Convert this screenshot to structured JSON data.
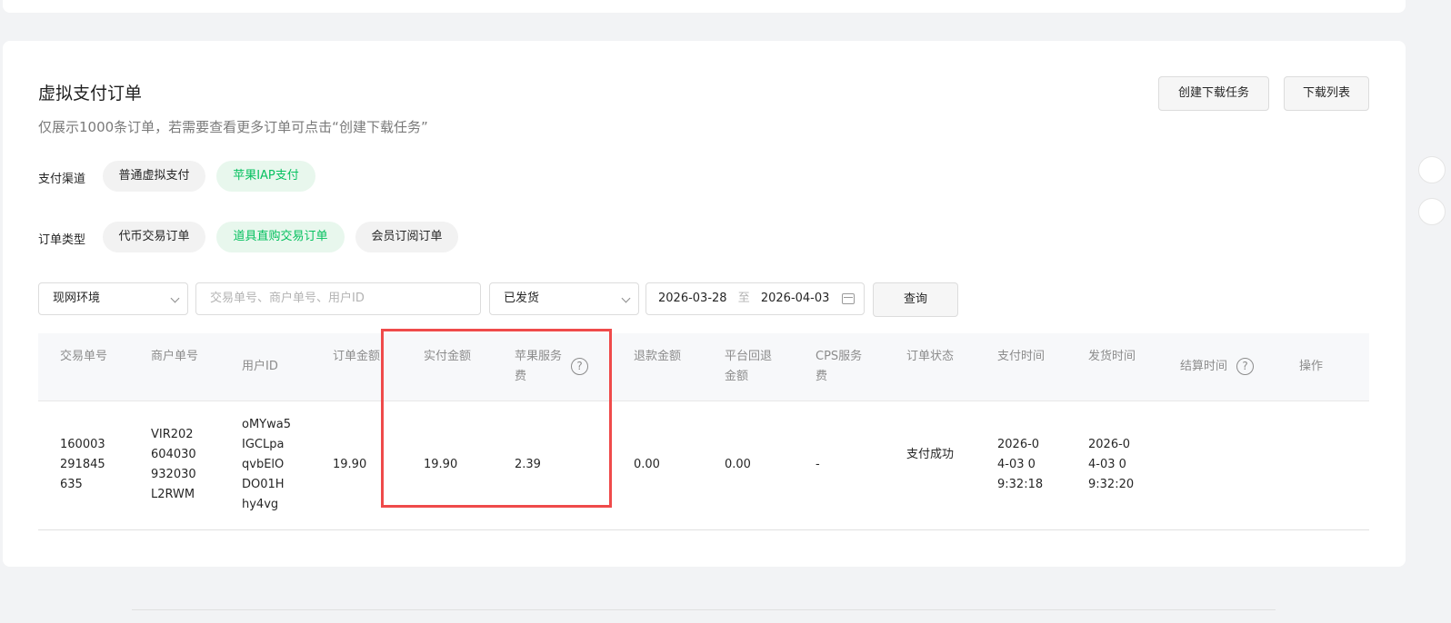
{
  "header": {
    "title": "虚拟支付订单",
    "subtitle": "仅展示1000条订单，若需要查看更多订单可点击“创建下载任务”",
    "create_download_label": "创建下载任务",
    "download_list_label": "下载列表"
  },
  "filters": {
    "channel_label": "支付渠道",
    "channels": [
      "普通虚拟支付",
      "苹果IAP支付"
    ],
    "channel_active": "苹果IAP支付",
    "type_label": "订单类型",
    "types": [
      "代币交易订单",
      "道具直购交易订单",
      "会员订阅订单"
    ],
    "type_active": "道具直购交易订单"
  },
  "search": {
    "env_value": "现网环境",
    "keyword_placeholder": "交易单号、商户单号、用户ID",
    "status_value": "已发货",
    "date_start": "2026-03-28",
    "date_sep": "至",
    "date_end": "2026-04-03",
    "query_label": "查询"
  },
  "table": {
    "columns": [
      "交易单号",
      "商户单号",
      "用户ID",
      "订单金额",
      "实付金额",
      "苹果服务费",
      "退款金额",
      "平台回退金额",
      "CPS服务费",
      "订单状态",
      "支付时间",
      "发货时间",
      "结算时间",
      "操作"
    ],
    "rows": [
      {
        "trade_no": "160003291845635",
        "merchant_no": "VIR202604030932030L2RWM",
        "user_id": "oMYwa5IGCLpaqvbElODO01Hhy4vg",
        "order_amount": "19.90",
        "paid_amount": "19.90",
        "apple_fee": "2.39",
        "refund_amount": "0.00",
        "platform_refund": "0.00",
        "cps_fee": "-",
        "status": "支付成功",
        "pay_time": "2026-04-03 09:32:18",
        "ship_time": "2026-04-03 09:32:20",
        "settle_time": "",
        "action": ""
      }
    ]
  },
  "colors": {
    "accent_green": "#07c160",
    "highlight_red": "#ef4a4a"
  }
}
